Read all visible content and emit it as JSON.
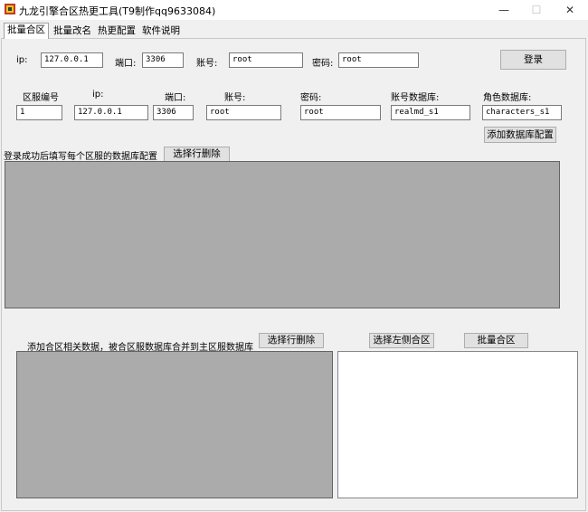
{
  "window": {
    "title": "九龙引擎合区热更工具(T9制作qq9633084)",
    "minimize": "—",
    "maximize": "☐",
    "close": "✕"
  },
  "tabs": [
    "批量合区",
    "批量改名",
    "热更配置",
    "软件说明"
  ],
  "login": {
    "ip_label": "ip:",
    "ip_value": "127.0.0.1",
    "port_label": "端口:",
    "port_value": "3306",
    "account_label": "账号:",
    "account_value": "root",
    "password_label": "密码:",
    "password_value": "root",
    "login_button": "登录"
  },
  "db_config": {
    "server_id_label": "区服编号",
    "ip_label": "ip:",
    "port_label": "端口:",
    "account_label": "账号:",
    "password_label": "密码:",
    "account_db_label": "账号数据库:",
    "role_db_label": "角色数据库:",
    "server_id_value": "1",
    "ip_value": "127.0.0.1",
    "port_value": "3306",
    "account_value": "root",
    "password_value": "root",
    "account_db_value": "realmd_s1",
    "role_db_value": "characters_s1",
    "add_button": "添加数据库配置"
  },
  "db_list": {
    "hint": "登录成功后填写每个区服的数据库配置",
    "delete_button": "选择行删除"
  },
  "merge": {
    "hint": "添加合区相关数据，被合区服数据库合并到主区服数据库",
    "delete_button": "选择行删除",
    "select_left_button": "选择左侧合区",
    "batch_merge_button": "批量合区"
  }
}
